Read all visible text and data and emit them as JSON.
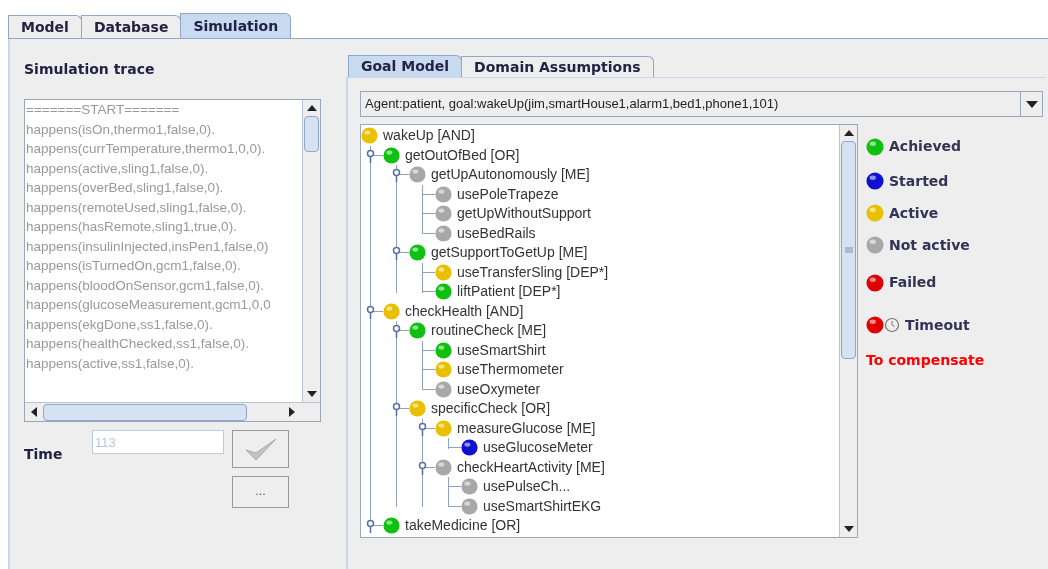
{
  "main_tabs": [
    {
      "label": "Model",
      "selected": false
    },
    {
      "label": "Database",
      "selected": false
    },
    {
      "label": "Simulation",
      "selected": true
    }
  ],
  "trace": {
    "title": "Simulation trace",
    "lines": [
      "=======START=======",
      "happens(isOn,thermo1,false,0).",
      "happens(currTemperature,thermo1,0,0).",
      "happens(active,sling1,false,0).",
      "happens(overBed,sling1,false,0).",
      "happens(remoteUsed,sling1,false,0).",
      "happens(hasRemote,sling1,true,0).",
      "happens(insulinInjected,insPen1,false,0)",
      "happens(isTurnedOn,gcm1,false,0).",
      "happens(bloodOnSensor,gcm1,false,0).",
      "happens(glucoseMeasurement,gcm1,0,0",
      "happens(ekgDone,ss1,false,0).",
      "happens(healthChecked,ss1,false,0).",
      "happens(active,ss1,false,0)."
    ]
  },
  "time": {
    "label": "Time",
    "value": "113",
    "more_button": "..."
  },
  "sub_tabs": [
    {
      "label": "Goal Model",
      "selected": true
    },
    {
      "label": "Domain Assumptions",
      "selected": false
    }
  ],
  "goal_select": "Agent:patient, goal:wakeUp(jim,smartHouse1,alarm1,bed1,phone1,101)",
  "tree": [
    {
      "label": "wakeUp [AND]",
      "color": "#e8c000",
      "children": [
        {
          "label": "getOutOfBed [OR]",
          "color": "#10c010",
          "expanded": true,
          "children": [
            {
              "label": "getUpAutonomously [ME]",
              "color": "#a8a8a8",
              "expanded": true,
              "children": [
                {
                  "label": "usePoleTrapeze",
                  "color": "#a8a8a8"
                },
                {
                  "label": "getUpWithoutSupport",
                  "color": "#a8a8a8"
                },
                {
                  "label": "useBedRails",
                  "color": "#a8a8a8"
                }
              ]
            },
            {
              "label": "getSupportToGetUp [ME]",
              "color": "#10c010",
              "expanded": true,
              "children": [
                {
                  "label": "useTransferSling [DEP*]",
                  "color": "#e8c000"
                },
                {
                  "label": "liftPatient [DEP*]",
                  "color": "#10c010"
                }
              ]
            }
          ]
        },
        {
          "label": "checkHealth [AND]",
          "color": "#e8c000",
          "expanded": true,
          "children": [
            {
              "label": "routineCheck [ME]",
              "color": "#10c010",
              "expanded": true,
              "children": [
                {
                  "label": "useSmartShirt",
                  "color": "#10c010"
                },
                {
                  "label": "useThermometer",
                  "color": "#e8c000"
                },
                {
                  "label": "useOxymeter",
                  "color": "#a8a8a8"
                }
              ]
            },
            {
              "label": "specificCheck [OR]",
              "color": "#e8c000",
              "expanded": true,
              "children": [
                {
                  "label": "measureGlucose [ME]",
                  "color": "#e8c000",
                  "expanded": true,
                  "children": [
                    {
                      "label": "useGlucoseMeter",
                      "color": "#1010d0"
                    }
                  ]
                },
                {
                  "label": "checkHeartActivity [ME]",
                  "color": "#a8a8a8",
                  "expanded": true,
                  "children": [
                    {
                      "label": "usePulseCh...",
                      "color": "#a8a8a8"
                    },
                    {
                      "label": "useSmartShirtEKG",
                      "color": "#a8a8a8"
                    }
                  ]
                }
              ]
            }
          ]
        },
        {
          "label": "takeMedicine [OR]",
          "color": "#10c010",
          "expanded": true
        }
      ]
    }
  ],
  "legend": [
    {
      "kind": "ball",
      "label": "Achieved",
      "color": "#10c010"
    },
    {
      "kind": "ball",
      "label": "Started",
      "color": "#1010d0"
    },
    {
      "kind": "ball",
      "label": "Active",
      "color": "#e8c000"
    },
    {
      "kind": "ball",
      "label": "Not active",
      "color": "#a8a8a8"
    },
    {
      "kind": "ball",
      "label": "Failed",
      "color": "#e00000"
    },
    {
      "kind": "timeout",
      "label": "Timeout",
      "color": "#e00000"
    },
    {
      "kind": "note",
      "label": "To compensate"
    }
  ]
}
